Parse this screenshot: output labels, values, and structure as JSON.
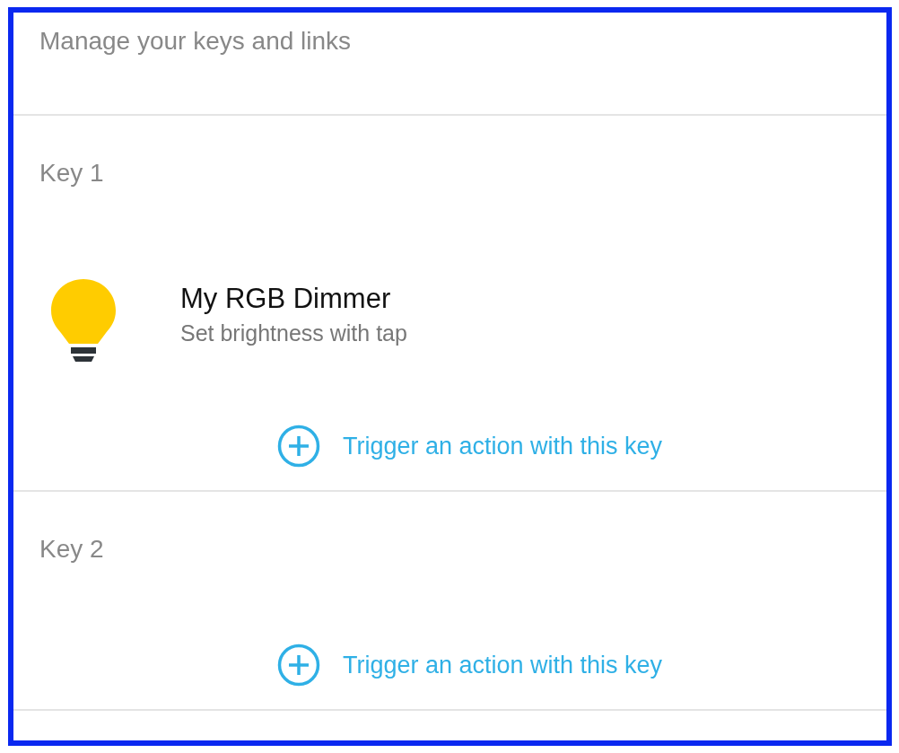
{
  "header": "Manage your keys and links",
  "keys": [
    {
      "label": "Key 1",
      "devices": [
        {
          "name": "My RGB Dimmer",
          "description": "Set brightness with tap"
        }
      ],
      "action": "Trigger an action with this key"
    },
    {
      "label": "Key 2",
      "action": "Trigger an action with this key"
    }
  ]
}
